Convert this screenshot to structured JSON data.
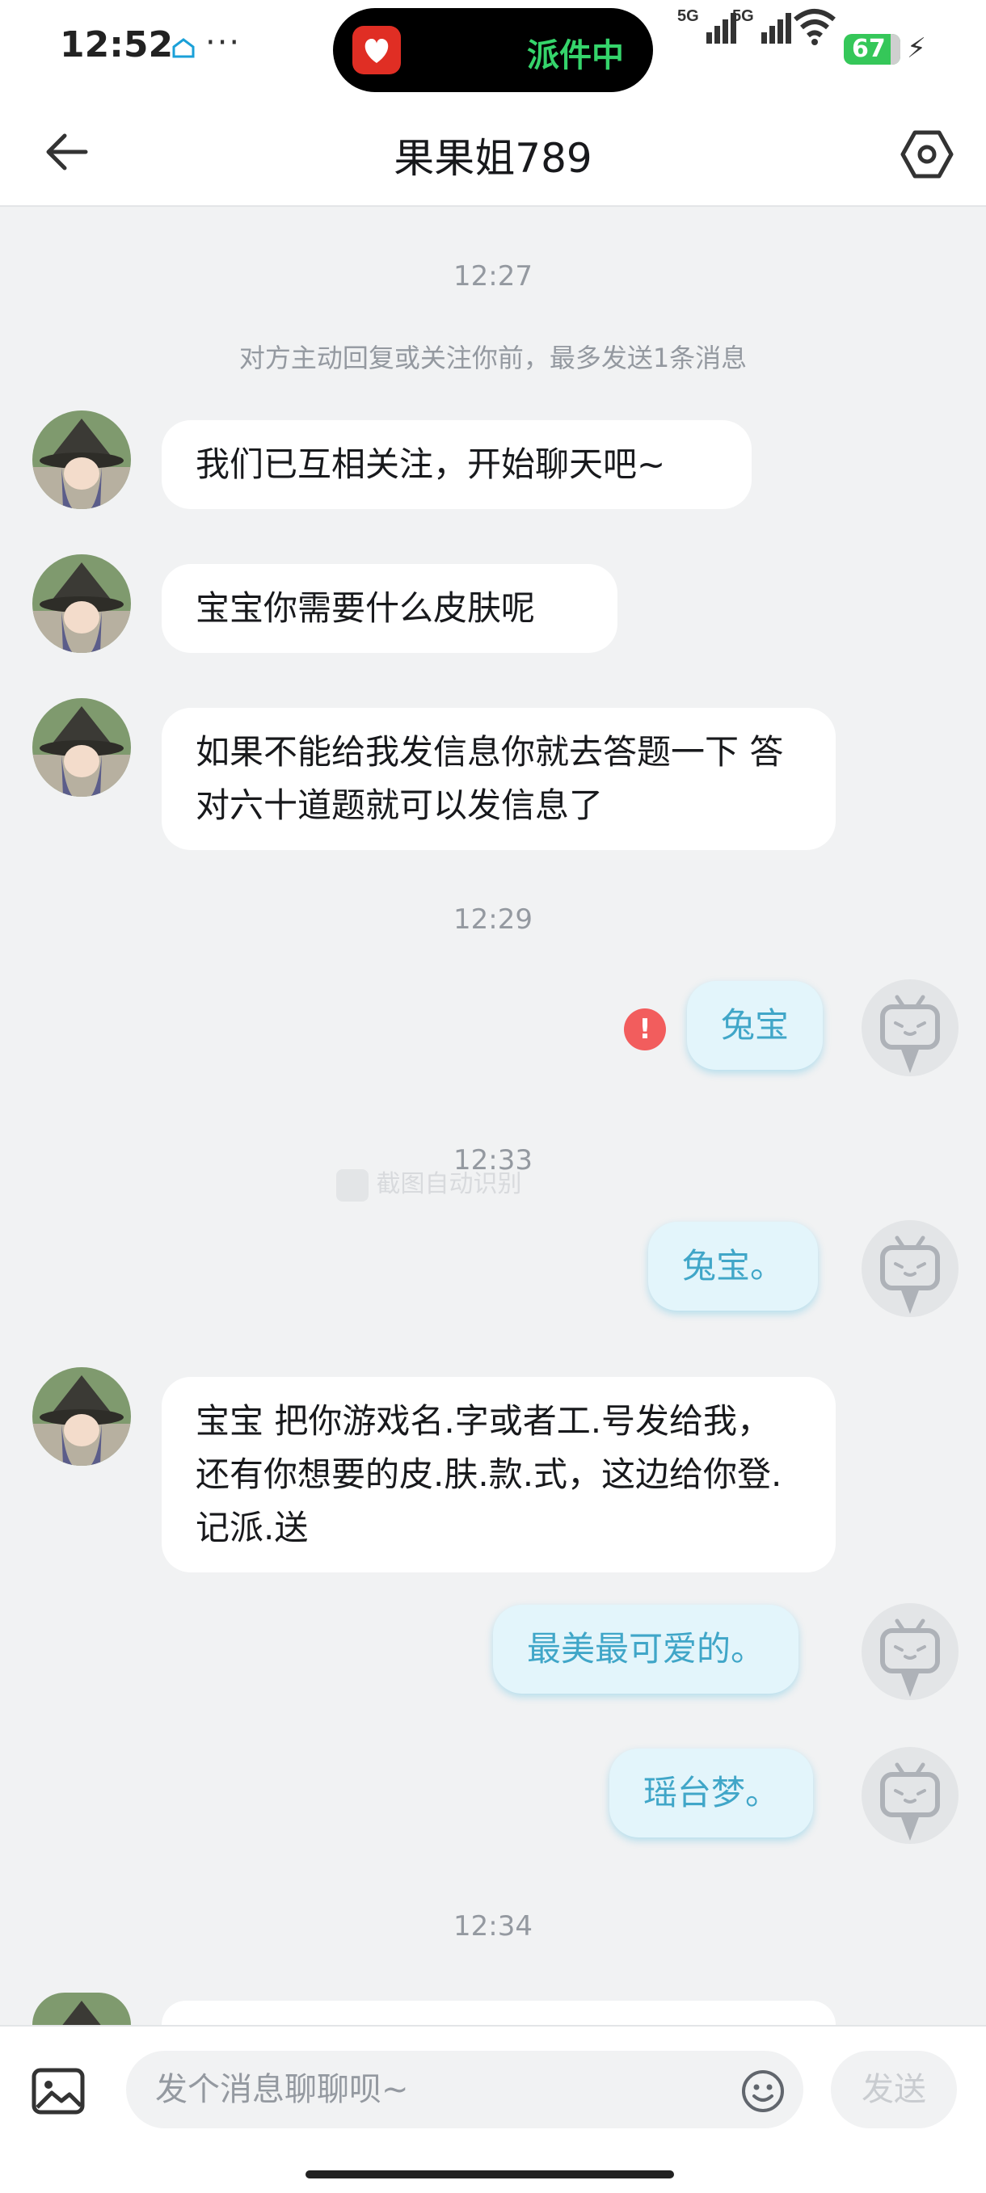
{
  "status_bar": {
    "time": "12:52",
    "dots": "···",
    "island_text": "派件中",
    "battery": "67",
    "signal_labels": [
      "5G",
      "5G"
    ]
  },
  "header": {
    "title": "果果姐789"
  },
  "chat": {
    "timestamps": [
      "12:27",
      "12:29",
      "12:33",
      "12:34"
    ],
    "notice": "对方主动回复或关注你前，最多发送1条消息",
    "messages": [
      {
        "side": "left",
        "text": "我们已互相关注，开始聊天吧~"
      },
      {
        "side": "left",
        "text": "宝宝你需要什么皮肤呢"
      },
      {
        "side": "left",
        "text": "如果不能给我发信息你就去答题一下 答对六十道题就可以发信息了"
      },
      {
        "side": "right",
        "text": "兔宝",
        "failed": true
      },
      {
        "side": "right",
        "text": "兔宝。"
      },
      {
        "side": "left",
        "text": "宝宝 把你游戏名.字或者工.号发给我，还有你想要的皮.肤.款.式，这边给你登.记派.送"
      },
      {
        "side": "right",
        "text": "最美最可爱的。"
      },
      {
        "side": "right",
        "text": "瑶台梦。"
      }
    ],
    "failed_mark": "!",
    "watermark": "截图自动识别"
  },
  "input_bar": {
    "placeholder": "发个消息聊聊呗~",
    "send_label": "发送"
  },
  "colors": {
    "bubble_right_bg": "#e3f5fb",
    "bubble_right_text": "#40a6c8",
    "accent_green": "#35d46b",
    "error_red": "#f25d5d"
  }
}
